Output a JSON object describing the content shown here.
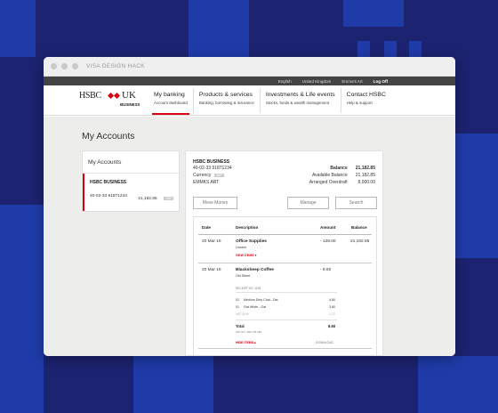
{
  "window": {
    "title": "VISA DESIGN HACK"
  },
  "topbar": {
    "links": [
      "English",
      "United Kingdom",
      "Emma's Art"
    ],
    "logoff": "Log Off"
  },
  "logo": {
    "brand": "HSBC",
    "country": "UK",
    "sub": "BUSINESS"
  },
  "nav": [
    {
      "main": "My banking",
      "sub": "Account dashboard"
    },
    {
      "main": "Products & services",
      "sub": "Banking, borrowing & insurance"
    },
    {
      "main": "Investments & Life events",
      "sub": "Stocks, funds & wealth management"
    },
    {
      "main": "Contact HSBC",
      "sub": "Help & support"
    }
  ],
  "page": {
    "title": "My Accounts"
  },
  "sidebar": {
    "heading": "My Accounts",
    "account": {
      "name": "HSBC BUSINESS",
      "number": "40-02-33 91871234",
      "balance": "21,182.85",
      "badge": "GBP"
    }
  },
  "account": {
    "name": "HSBC BUSINESS",
    "number": "40-02-33 91871234",
    "currency_label": "Currency",
    "currency_badge": "GBP",
    "holder": "EMMKS ART",
    "balance_label": "Balance",
    "balance": "21,182.85",
    "available_label": "Available Balance",
    "available": "21,182.85",
    "overdraft_label": "Arranged Overdraft",
    "overdraft": "8,000.00"
  },
  "buttons": {
    "move": "Move Money",
    "manage": "Manage",
    "search": "Search"
  },
  "table": {
    "headers": {
      "date": "Date",
      "description": "Description",
      "amount": "Amount",
      "balance": "Balance"
    },
    "rows": [
      {
        "date": "20 Mar 19",
        "desc": "Office Supplies",
        "sub": "London",
        "amount": "- 128.00",
        "balance": "21,182.85",
        "view": "VIEW ITEMS"
      },
      {
        "date": "20 Mar 19",
        "desc": "Blacksheep Coffee",
        "sub": "Old Street",
        "amount": "- 8.60",
        "balance": ""
      }
    ],
    "receipt": {
      "label": "RECEIPT NO. 1128",
      "items": [
        {
          "qty": "01",
          "name": "Medium Dirty Chai - Oat",
          "price": "4.80"
        },
        {
          "qty": "01",
          "name": "Flat White - Oat",
          "price": "3.80"
        }
      ],
      "vat_label": "VAT 20%",
      "vat": "1.72",
      "total_label": "Total",
      "total": "8.60",
      "vat_no": "VAT NO. 260 778 180",
      "hide": "HIDE ITEMS",
      "download": "DOWNLOAD"
    }
  }
}
